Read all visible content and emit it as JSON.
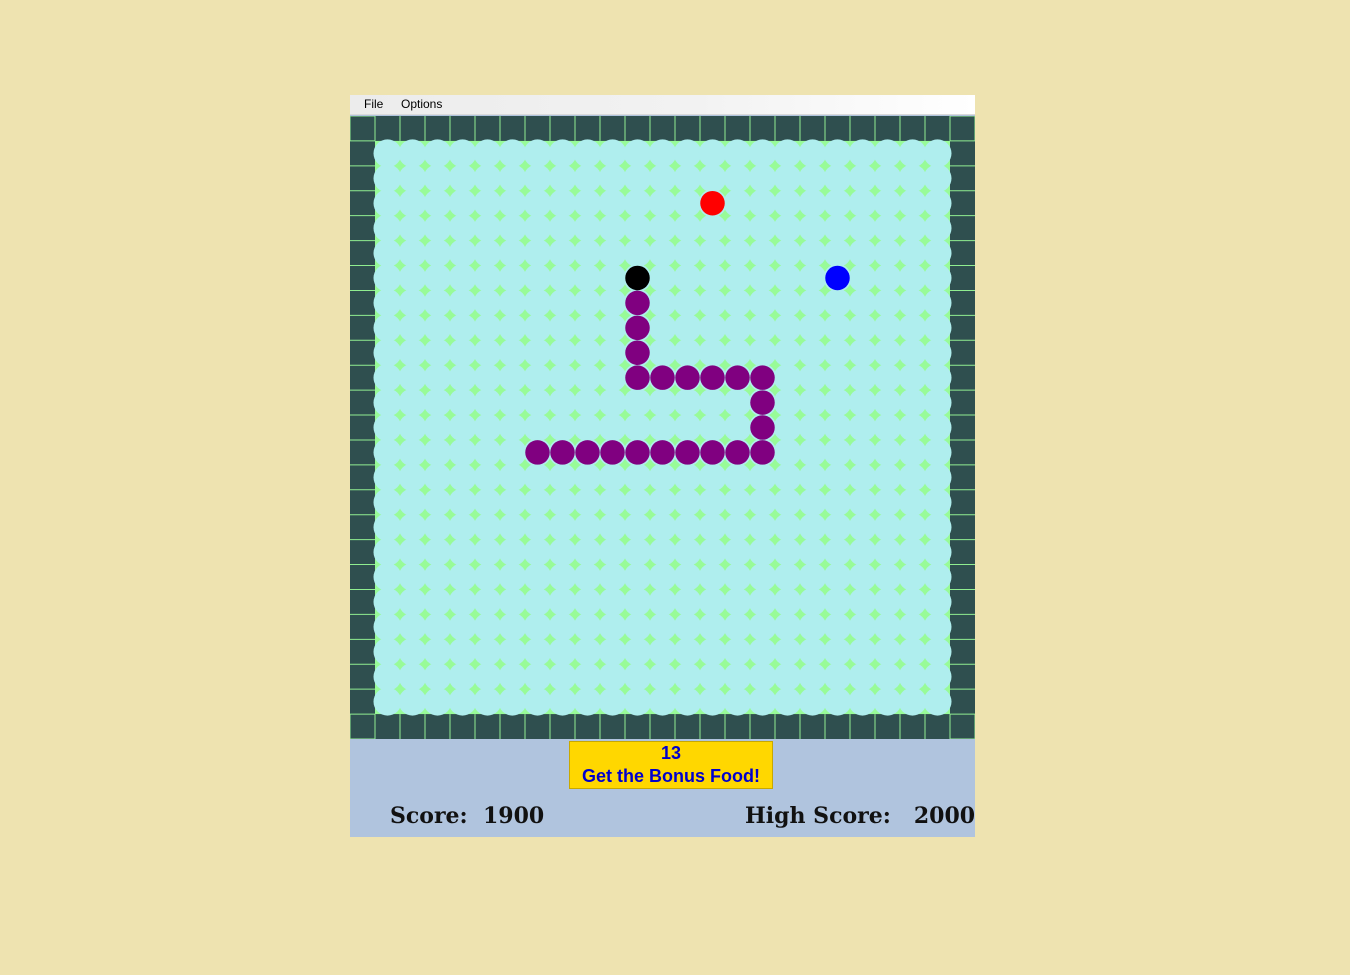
{
  "menu": {
    "file_label": "File",
    "options_label": "Options"
  },
  "game": {
    "grid_cols": 25,
    "grid_rows": 25,
    "colors": {
      "page_background": "#EEE3B0",
      "wall": "#2F4F4F",
      "wall_grid_line": "#90EE90",
      "field_cell": "#AFEEEE",
      "field_gap": "#98FB98",
      "snake_head": "#000000",
      "snake_body": "#800080",
      "food": "#FF0000",
      "bonus_food": "#0000FF",
      "hud_background": "#B0C4DE",
      "bonus_box": "#FFD700",
      "bonus_text": "#0000CD"
    },
    "snake_head_cell": [
      11,
      6
    ],
    "snake_body_cells": [
      [
        11,
        7
      ],
      [
        11,
        8
      ],
      [
        11,
        9
      ],
      [
        11,
        10
      ],
      [
        12,
        10
      ],
      [
        13,
        10
      ],
      [
        14,
        10
      ],
      [
        15,
        10
      ],
      [
        16,
        10
      ],
      [
        16,
        11
      ],
      [
        16,
        12
      ],
      [
        16,
        13
      ],
      [
        15,
        13
      ],
      [
        14,
        13
      ],
      [
        13,
        13
      ],
      [
        12,
        13
      ],
      [
        11,
        13
      ],
      [
        10,
        13
      ],
      [
        9,
        13
      ],
      [
        8,
        13
      ],
      [
        7,
        13
      ]
    ],
    "food_cell": [
      14,
      3
    ],
    "bonus_food_cell": [
      19,
      6
    ]
  },
  "bonus": {
    "countdown": "13",
    "message": "Get the Bonus Food!"
  },
  "score": {
    "label": "Score:",
    "value": "1900",
    "high_label": "High Score:",
    "high_value": "2000"
  }
}
